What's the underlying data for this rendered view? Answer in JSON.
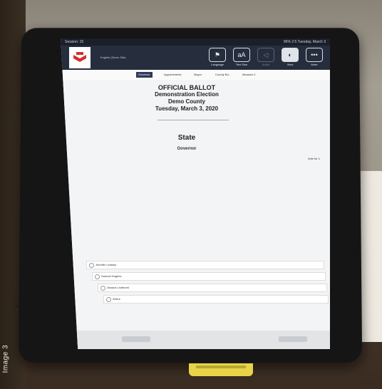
{
  "photo_credit": "Image 3",
  "screen": {
    "status_left": "Session: 15",
    "status_right": "96% 2:5 Tuesday, March 3",
    "header_title": "English (Demo Site)",
    "toolbar": [
      {
        "label": "Language",
        "icon": "flag-icon"
      },
      {
        "label": "Text Size",
        "icon": "text-size-icon"
      },
      {
        "label": "Audio",
        "icon": "speaker-icon"
      },
      {
        "label": "View",
        "icon": "view-icon"
      },
      {
        "label": "More",
        "icon": "more-icon"
      }
    ],
    "tabs": [
      "Governor",
      "Appointments",
      "Mayor",
      "County Bd...",
      "Measure 1"
    ],
    "ballot_heading": [
      "OFFICIAL BALLOT",
      "Demonstration Election",
      "Demo County",
      "Tuesday, March 3, 2020"
    ],
    "section": "State",
    "contest": "Governor",
    "vote_for": "Vote for 1",
    "options": [
      "Jennifer Lindsey",
      "Samuel Hughes",
      "Jessica Lindhorst",
      "Arthur"
    ],
    "colors": {
      "header": "#262d3d",
      "logo_red": "#d32f2f",
      "stand": "#e8d448"
    }
  }
}
